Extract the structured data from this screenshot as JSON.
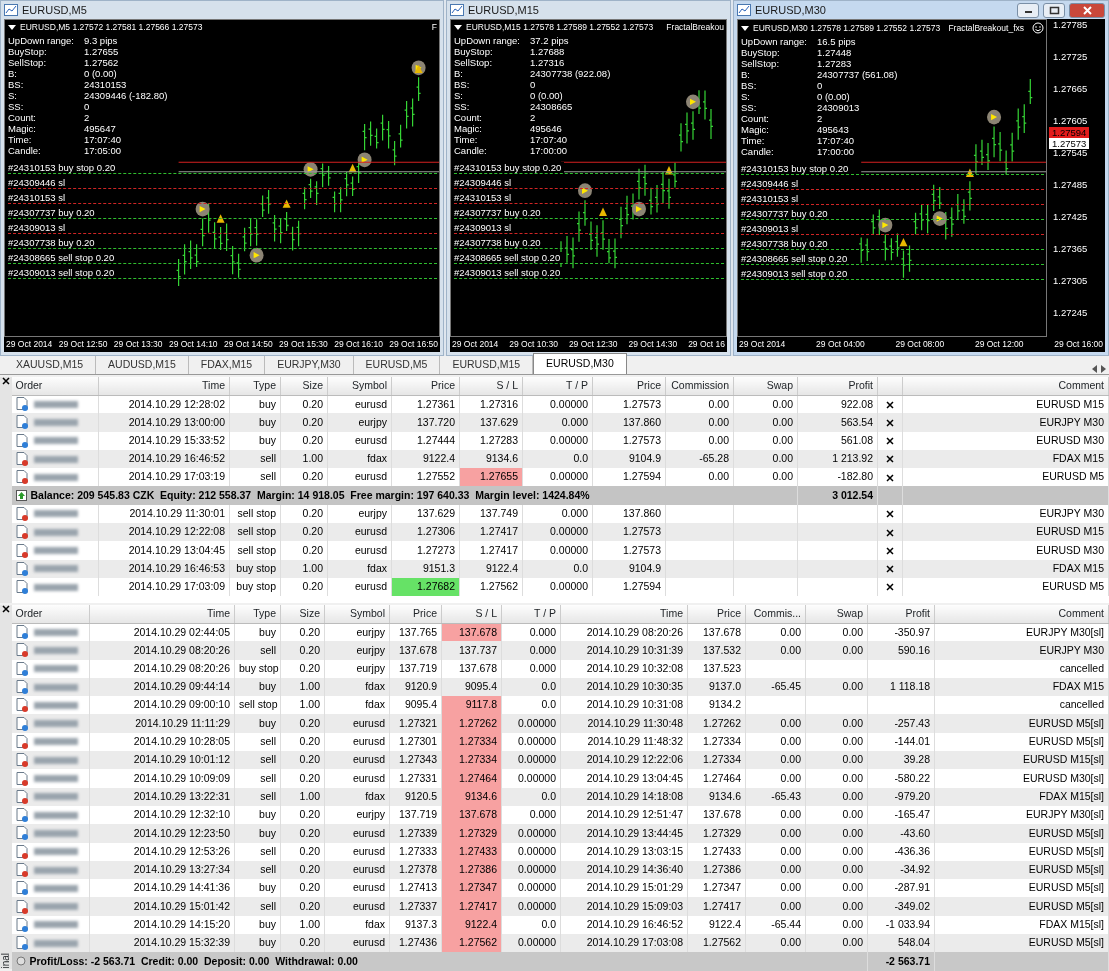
{
  "chart_windows": [
    {
      "title": "EURUSD,M5",
      "active": false,
      "header": "EURUSD,M5  1.27572 1.27581 1.27566 1.27573",
      "expert": "F",
      "info": [
        {
          "label": "UpDown range:",
          "value": "9.3 pips"
        },
        {
          "label": "BuyStop:",
          "value": "1.27655"
        },
        {
          "label": "SellStop:",
          "value": "1.27562"
        },
        {
          "label": "B:",
          "value": "0 (0.00)"
        },
        {
          "label": "BS:",
          "value": "24310153"
        },
        {
          "label": "S:",
          "value": "24309446 (-182.80)"
        },
        {
          "label": "SS:",
          "value": "0"
        },
        {
          "label": "Count:",
          "value": "2"
        },
        {
          "label": "Magic:",
          "value": "495647"
        },
        {
          "label": "Time:",
          "value": "17:07:40"
        },
        {
          "label": "Candle:",
          "value": "17:05:00"
        }
      ],
      "order_lines": [
        {
          "text": "#24310153 buy stop 0.20",
          "kind": "entry"
        },
        {
          "text": "#24309446 sl",
          "kind": "stop"
        },
        {
          "text": "#24310153 sl",
          "kind": "stop"
        },
        {
          "text": "#24307737 buy 0.20",
          "kind": "entry"
        },
        {
          "text": "#24309013 sl",
          "kind": "stop"
        },
        {
          "text": "#24307738 buy 0.20",
          "kind": "entry"
        },
        {
          "text": "#24308665 sell stop 0.20",
          "kind": "entry"
        },
        {
          "text": "#24309013 sell stop 0.20",
          "kind": "entry"
        }
      ],
      "time_labels": [
        "29 Oct 2014",
        "29 Oct 12:50",
        "29 Oct 13:30",
        "29 Oct 14:10",
        "29 Oct 14:50",
        "29 Oct 15:30",
        "29 Oct 16:10",
        "29 Oct 16:50"
      ]
    },
    {
      "title": "EURUSD,M15",
      "active": false,
      "header": "EURUSD,M15  1.27578 1.27589 1.27552 1.27573",
      "expert": "FractalBreakou",
      "info": [
        {
          "label": "UpDown range:",
          "value": "37.2 pips"
        },
        {
          "label": "BuyStop:",
          "value": "1.27688"
        },
        {
          "label": "SellStop:",
          "value": "1.27316"
        },
        {
          "label": "B:",
          "value": "24307738 (922.08)"
        },
        {
          "label": "BS:",
          "value": "0"
        },
        {
          "label": "S:",
          "value": "0 (0.00)"
        },
        {
          "label": "SS:",
          "value": "24308665"
        },
        {
          "label": "Count:",
          "value": "2"
        },
        {
          "label": "Magic:",
          "value": "495646"
        },
        {
          "label": "Time:",
          "value": "17:07:40"
        },
        {
          "label": "Candle:",
          "value": "17:00:00"
        }
      ],
      "order_lines": [
        {
          "text": "#24310153 buy stop 0.20",
          "kind": "entry"
        },
        {
          "text": "#24309446 sl",
          "kind": "stop"
        },
        {
          "text": "#24310153 sl",
          "kind": "stop"
        },
        {
          "text": "#24307737 buy 0.20",
          "kind": "entry"
        },
        {
          "text": "#24309013 sl",
          "kind": "stop"
        },
        {
          "text": "#24307738 buy 0.20",
          "kind": "entry"
        },
        {
          "text": "#24308665 sell stop 0.20",
          "kind": "entry"
        },
        {
          "text": "#24309013 sell stop 0.20",
          "kind": "entry"
        }
      ],
      "time_labels": [
        "29 Oct 2014",
        "29 Oct 10:30",
        "29 Oct 12:30",
        "29 Oct 14:30",
        "29 Oct 16"
      ]
    },
    {
      "title": "EURUSD,M30",
      "active": true,
      "header": "EURUSD,M30  1.27578 1.27589 1.27552 1.27573",
      "expert": "FractalBreakout_fxs",
      "info": [
        {
          "label": "UpDown range:",
          "value": "16.5 pips"
        },
        {
          "label": "BuyStop:",
          "value": "1.27448"
        },
        {
          "label": "SellStop:",
          "value": "1.27283"
        },
        {
          "label": "B:",
          "value": "24307737 (561.08)"
        },
        {
          "label": "BS:",
          "value": "0"
        },
        {
          "label": "S:",
          "value": "0 (0.00)"
        },
        {
          "label": "SS:",
          "value": "24309013"
        },
        {
          "label": "Count:",
          "value": "2"
        },
        {
          "label": "Magic:",
          "value": "495643"
        },
        {
          "label": "Time:",
          "value": "17:07:40"
        },
        {
          "label": "Candle:",
          "value": "17:00:00"
        }
      ],
      "order_lines": [
        {
          "text": "#24310153 buy stop 0.20",
          "kind": "entry"
        },
        {
          "text": "#24309446 sl",
          "kind": "stop"
        },
        {
          "text": "#24310153 sl",
          "kind": "stop"
        },
        {
          "text": "#24307737 buy 0.20",
          "kind": "entry"
        },
        {
          "text": "#24309013 sl",
          "kind": "stop"
        },
        {
          "text": "#24307738 buy 0.20",
          "kind": "entry"
        },
        {
          "text": "#24308665 sell stop 0.20",
          "kind": "entry"
        },
        {
          "text": "#24309013 sell stop 0.20",
          "kind": "entry"
        }
      ],
      "time_labels": [
        "29 Oct 2014",
        "29 Oct 04:00",
        "29 Oct 08:00",
        "29 Oct 12:00",
        "29 Oct 16:00"
      ],
      "price_ticks": [
        "1.27785",
        "1.27725",
        "1.27665",
        "1.27605",
        "1.27545",
        "1.27485",
        "1.27425",
        "1.27365",
        "1.27305",
        "1.27245"
      ],
      "price_markers": [
        {
          "text": "1.27594",
          "color": "#e31b1b"
        },
        {
          "text": "1.27573",
          "color": "#ffffff"
        }
      ]
    }
  ],
  "chart_tabs": [
    {
      "label": "XAUUSD,M15",
      "selected": false
    },
    {
      "label": "AUDUSD,M15",
      "selected": false
    },
    {
      "label": "FDAX,M15",
      "selected": false
    },
    {
      "label": "EURJPY,M30",
      "selected": false
    },
    {
      "label": "EURUSD,M5",
      "selected": false
    },
    {
      "label": "EURUSD,M15",
      "selected": false
    },
    {
      "label": "EURUSD,M30",
      "selected": true
    }
  ],
  "trade_table": {
    "columns": [
      "Order",
      "Time",
      "Type",
      "Size",
      "Symbol",
      "Price",
      "S / L",
      "T / P",
      "Price",
      "Commission",
      "Swap",
      "Profit",
      "Comment"
    ],
    "positions": [
      {
        "kind": "buy",
        "sl_hit": false,
        "cells": [
          "",
          "2014.10.29 12:28:02",
          "buy",
          "0.20",
          "eurusd",
          "1.27361",
          "1.27316",
          "0.00000",
          "1.27573",
          "0.00",
          "0.00",
          "922.08",
          "EURUSD M15"
        ]
      },
      {
        "kind": "buy",
        "sl_hit": false,
        "cells": [
          "",
          "2014.10.29 13:00:00",
          "buy",
          "0.20",
          "eurjpy",
          "137.720",
          "137.629",
          "0.000",
          "137.860",
          "0.00",
          "0.00",
          "563.54",
          "EURJPY M30"
        ]
      },
      {
        "kind": "buy",
        "sl_hit": false,
        "cells": [
          "",
          "2014.10.29 15:33:52",
          "buy",
          "0.20",
          "eurusd",
          "1.27444",
          "1.27283",
          "0.00000",
          "1.27573",
          "0.00",
          "0.00",
          "561.08",
          "EURUSD M30"
        ]
      },
      {
        "kind": "sell",
        "sl_hit": false,
        "cells": [
          "",
          "2014.10.29 16:46:52",
          "sell",
          "1.00",
          "fdax",
          "9122.4",
          "9134.6",
          "0.0",
          "9104.9",
          "-65.28",
          "0.00",
          "1 213.92",
          "FDAX M15"
        ]
      },
      {
        "kind": "sell",
        "sl_hit": true,
        "cells": [
          "",
          "2014.10.29 17:03:19",
          "sell",
          "0.20",
          "eurusd",
          "1.27552",
          "1.27655",
          "0.00000",
          "1.27594",
          "0.00",
          "0.00",
          "-182.80",
          "EURUSD M5"
        ]
      }
    ],
    "summary": {
      "text": "Balance: 209 545.83 CZK  Equity: 212 558.37  Margin: 14 918.05  Free margin: 197 640.33  Margin level: 1424.84%",
      "profit": "3 012.54"
    },
    "pending": [
      {
        "kind": "sell",
        "price_hit": false,
        "cells": [
          "",
          "2014.10.29 11:30:01",
          "sell stop",
          "0.20",
          "eurjpy",
          "137.629",
          "137.749",
          "0.000",
          "137.860",
          "",
          "",
          "",
          "EURJPY M30"
        ]
      },
      {
        "kind": "sell",
        "price_hit": false,
        "cells": [
          "",
          "2014.10.29 12:22:08",
          "sell stop",
          "0.20",
          "eurusd",
          "1.27306",
          "1.27417",
          "0.00000",
          "1.27573",
          "",
          "",
          "",
          "EURUSD M15"
        ]
      },
      {
        "kind": "sell",
        "price_hit": false,
        "cells": [
          "",
          "2014.10.29 13:04:45",
          "sell stop",
          "0.20",
          "eurusd",
          "1.27273",
          "1.27417",
          "0.00000",
          "1.27573",
          "",
          "",
          "",
          "EURUSD M30"
        ]
      },
      {
        "kind": "buy",
        "price_hit": false,
        "cells": [
          "",
          "2014.10.29 16:46:53",
          "buy stop",
          "1.00",
          "fdax",
          "9151.3",
          "9122.4",
          "0.0",
          "9104.9",
          "",
          "",
          "",
          "FDAX M15"
        ]
      },
      {
        "kind": "buy",
        "price_hit": true,
        "cells": [
          "",
          "2014.10.29 17:03:09",
          "buy stop",
          "0.20",
          "eurusd",
          "1.27682",
          "1.27562",
          "0.00000",
          "1.27594",
          "",
          "",
          "",
          "EURUSD M5"
        ]
      }
    ]
  },
  "history_table": {
    "columns": [
      "Order",
      "Time",
      "Type",
      "Size",
      "Symbol",
      "Price",
      "S / L",
      "T / P",
      "Time",
      "Price",
      "Commis...",
      "Swap",
      "Profit",
      "Comment"
    ],
    "rows": [
      {
        "kind": "buy",
        "sl_hit": true,
        "cells": [
          "",
          "2014.10.29 02:44:05",
          "buy",
          "0.20",
          "eurjpy",
          "137.765",
          "137.678",
          "0.000",
          "2014.10.29 08:20:26",
          "137.678",
          "0.00",
          "0.00",
          "-350.97",
          "EURJPY M30[sl]"
        ]
      },
      {
        "kind": "sell",
        "sl_hit": false,
        "cells": [
          "",
          "2014.10.29 08:20:26",
          "sell",
          "0.20",
          "eurjpy",
          "137.678",
          "137.737",
          "0.000",
          "2014.10.29 10:31:39",
          "137.532",
          "0.00",
          "0.00",
          "590.16",
          "EURJPY M30"
        ]
      },
      {
        "kind": "buy",
        "sl_hit": false,
        "cells": [
          "",
          "2014.10.29 08:20:26",
          "buy stop",
          "0.20",
          "eurjpy",
          "137.719",
          "137.678",
          "0.000",
          "2014.10.29 10:32:08",
          "137.523",
          "",
          "",
          "",
          "cancelled"
        ]
      },
      {
        "kind": "buy",
        "sl_hit": false,
        "cells": [
          "",
          "2014.10.29 09:44:14",
          "buy",
          "1.00",
          "fdax",
          "9120.9",
          "9095.4",
          "0.0",
          "2014.10.29 10:30:35",
          "9137.0",
          "-65.45",
          "0.00",
          "1 118.18",
          "FDAX M15"
        ]
      },
      {
        "kind": "sell",
        "sl_hit": true,
        "cells": [
          "",
          "2014.10.29 09:00:10",
          "sell stop",
          "1.00",
          "fdax",
          "9095.4",
          "9117.8",
          "0.0",
          "2014.10.29 10:31:08",
          "9134.2",
          "",
          "",
          "",
          "cancelled"
        ]
      },
      {
        "kind": "buy",
        "sl_hit": true,
        "cells": [
          "",
          "2014.10.29 11:11:29",
          "buy",
          "0.20",
          "eurusd",
          "1.27321",
          "1.27262",
          "0.00000",
          "2014.10.29 11:30:48",
          "1.27262",
          "0.00",
          "0.00",
          "-257.43",
          "EURUSD M5[sl]"
        ]
      },
      {
        "kind": "sell",
        "sl_hit": true,
        "cells": [
          "",
          "2014.10.29 10:28:05",
          "sell",
          "0.20",
          "eurusd",
          "1.27301",
          "1.27334",
          "0.00000",
          "2014.10.29 11:48:32",
          "1.27334",
          "0.00",
          "0.00",
          "-144.01",
          "EURUSD M5[sl]"
        ]
      },
      {
        "kind": "sell",
        "sl_hit": true,
        "cells": [
          "",
          "2014.10.29 10:01:12",
          "sell",
          "0.20",
          "eurusd",
          "1.27343",
          "1.27334",
          "0.00000",
          "2014.10.29 12:22:06",
          "1.27334",
          "0.00",
          "0.00",
          "39.28",
          "EURUSD M15[sl]"
        ]
      },
      {
        "kind": "sell",
        "sl_hit": true,
        "cells": [
          "",
          "2014.10.29 10:09:09",
          "sell",
          "0.20",
          "eurusd",
          "1.27331",
          "1.27464",
          "0.00000",
          "2014.10.29 13:04:45",
          "1.27464",
          "0.00",
          "0.00",
          "-580.22",
          "EURUSD M30[sl]"
        ]
      },
      {
        "kind": "sell",
        "sl_hit": true,
        "cells": [
          "",
          "2014.10.29 13:22:31",
          "sell",
          "1.00",
          "fdax",
          "9120.5",
          "9134.6",
          "0.0",
          "2014.10.29 14:18:08",
          "9134.6",
          "-65.43",
          "0.00",
          "-979.20",
          "FDAX M15[sl]"
        ]
      },
      {
        "kind": "buy",
        "sl_hit": true,
        "cells": [
          "",
          "2014.10.29 12:32:10",
          "buy",
          "0.20",
          "eurjpy",
          "137.719",
          "137.678",
          "0.000",
          "2014.10.29 12:51:47",
          "137.678",
          "0.00",
          "0.00",
          "-165.47",
          "EURJPY M30[sl]"
        ]
      },
      {
        "kind": "buy",
        "sl_hit": true,
        "cells": [
          "",
          "2014.10.29 12:23:50",
          "buy",
          "0.20",
          "eurusd",
          "1.27339",
          "1.27329",
          "0.00000",
          "2014.10.29 13:44:45",
          "1.27329",
          "0.00",
          "0.00",
          "-43.60",
          "EURUSD M5[sl]"
        ]
      },
      {
        "kind": "sell",
        "sl_hit": true,
        "cells": [
          "",
          "2014.10.29 12:53:26",
          "sell",
          "0.20",
          "eurusd",
          "1.27333",
          "1.27433",
          "0.00000",
          "2014.10.29 13:03:15",
          "1.27433",
          "0.00",
          "0.00",
          "-436.36",
          "EURUSD M5[sl]"
        ]
      },
      {
        "kind": "sell",
        "sl_hit": true,
        "cells": [
          "",
          "2014.10.29 13:27:34",
          "sell",
          "0.20",
          "eurusd",
          "1.27378",
          "1.27386",
          "0.00000",
          "2014.10.29 14:36:40",
          "1.27386",
          "0.00",
          "0.00",
          "-34.92",
          "EURUSD M5[sl]"
        ]
      },
      {
        "kind": "buy",
        "sl_hit": true,
        "cells": [
          "",
          "2014.10.29 14:41:36",
          "buy",
          "0.20",
          "eurusd",
          "1.27413",
          "1.27347",
          "0.00000",
          "2014.10.29 15:01:29",
          "1.27347",
          "0.00",
          "0.00",
          "-287.91",
          "EURUSD M5[sl]"
        ]
      },
      {
        "kind": "sell",
        "sl_hit": true,
        "cells": [
          "",
          "2014.10.29 15:01:42",
          "sell",
          "0.20",
          "eurusd",
          "1.27337",
          "1.27417",
          "0.00000",
          "2014.10.29 15:09:03",
          "1.27417",
          "0.00",
          "0.00",
          "-349.02",
          "EURUSD M5[sl]"
        ]
      },
      {
        "kind": "buy",
        "sl_hit": true,
        "cells": [
          "",
          "2014.10.29 14:15:20",
          "buy",
          "1.00",
          "fdax",
          "9137.3",
          "9122.4",
          "0.0",
          "2014.10.29 16:46:52",
          "9122.4",
          "-65.44",
          "0.00",
          "-1 033.94",
          "FDAX M15[sl]"
        ]
      },
      {
        "kind": "buy",
        "sl_hit": true,
        "cells": [
          "",
          "2014.10.29 15:32:39",
          "buy",
          "0.20",
          "eurusd",
          "1.27436",
          "1.27562",
          "0.00000",
          "2014.10.29 17:03:08",
          "1.27562",
          "0.00",
          "0.00",
          "548.04",
          "EURUSD M5[sl]"
        ]
      }
    ],
    "footer": {
      "text": "Profit/Loss: -2 563.71  Credit: 0.00  Deposit: 0.00  Withdrawal: 0.00",
      "profit": "-2 563.71"
    }
  },
  "side_label": "inal"
}
